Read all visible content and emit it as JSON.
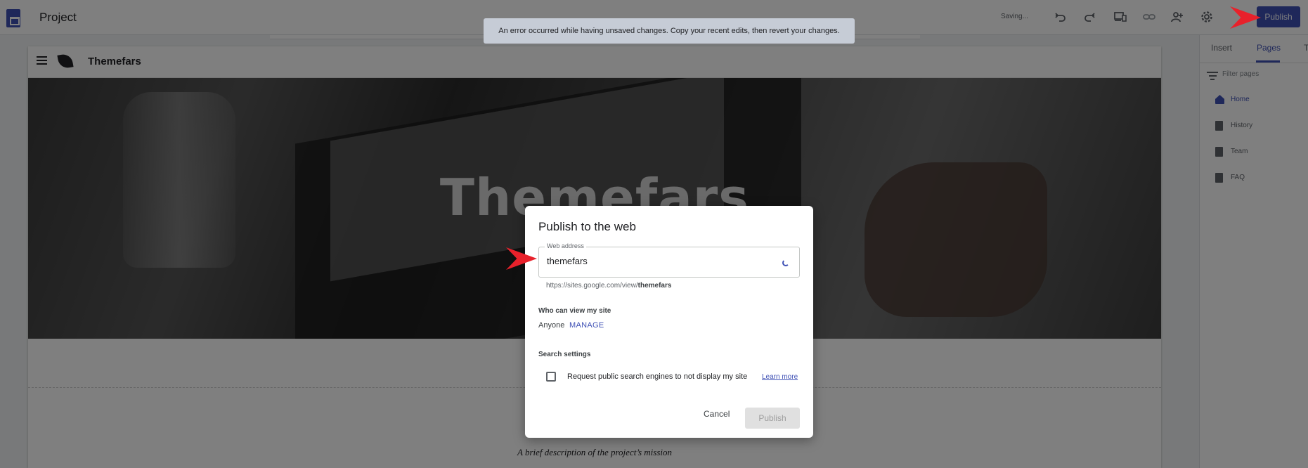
{
  "app": {
    "project_title": "Project",
    "saving_status": "Saving...",
    "publish_label": "Publish",
    "toolbar_icons": [
      "undo-icon",
      "redo-icon",
      "preview-devices-icon",
      "link-icon",
      "add-person-icon",
      "gear-icon"
    ]
  },
  "toast": {
    "message": "An error occurred while having unsaved changes. Copy your recent edits, then revert your changes."
  },
  "site": {
    "name": "Themefars",
    "hero_title": "Themefars",
    "tagline": "A brief description of the project’s mission"
  },
  "right_panel": {
    "tabs": [
      {
        "label": "Insert",
        "active": false
      },
      {
        "label": "Pages",
        "active": true
      },
      {
        "label": "Th",
        "active": false
      }
    ],
    "filter_placeholder": "Filter pages",
    "pages": [
      {
        "label": "Home",
        "active": true,
        "icon": "home-icon"
      },
      {
        "label": "History",
        "active": false,
        "icon": "page-icon"
      },
      {
        "label": "Team",
        "active": false,
        "icon": "page-icon"
      },
      {
        "label": "FAQ",
        "active": false,
        "icon": "page-icon"
      }
    ]
  },
  "dialog": {
    "title": "Publish to the web",
    "web_address_label": "Web address",
    "web_address_value": "themefars",
    "url_prefix": "https://sites.google.com/view/",
    "url_slug": "themefars",
    "who_can_view_label": "Who can view my site",
    "viewer_value": "Anyone",
    "manage_label": "MANAGE",
    "search_settings_label": "Search settings",
    "search_checkbox_label": "Request public search engines to not display my site",
    "search_checkbox_checked": false,
    "learn_more_label": "Learn more",
    "cancel_label": "Cancel",
    "publish_label": "Publish"
  },
  "colors": {
    "accent": "#3f51b5",
    "annotation_arrow": "#e8212b",
    "overlay": "rgba(0,0,0,0.5)"
  }
}
